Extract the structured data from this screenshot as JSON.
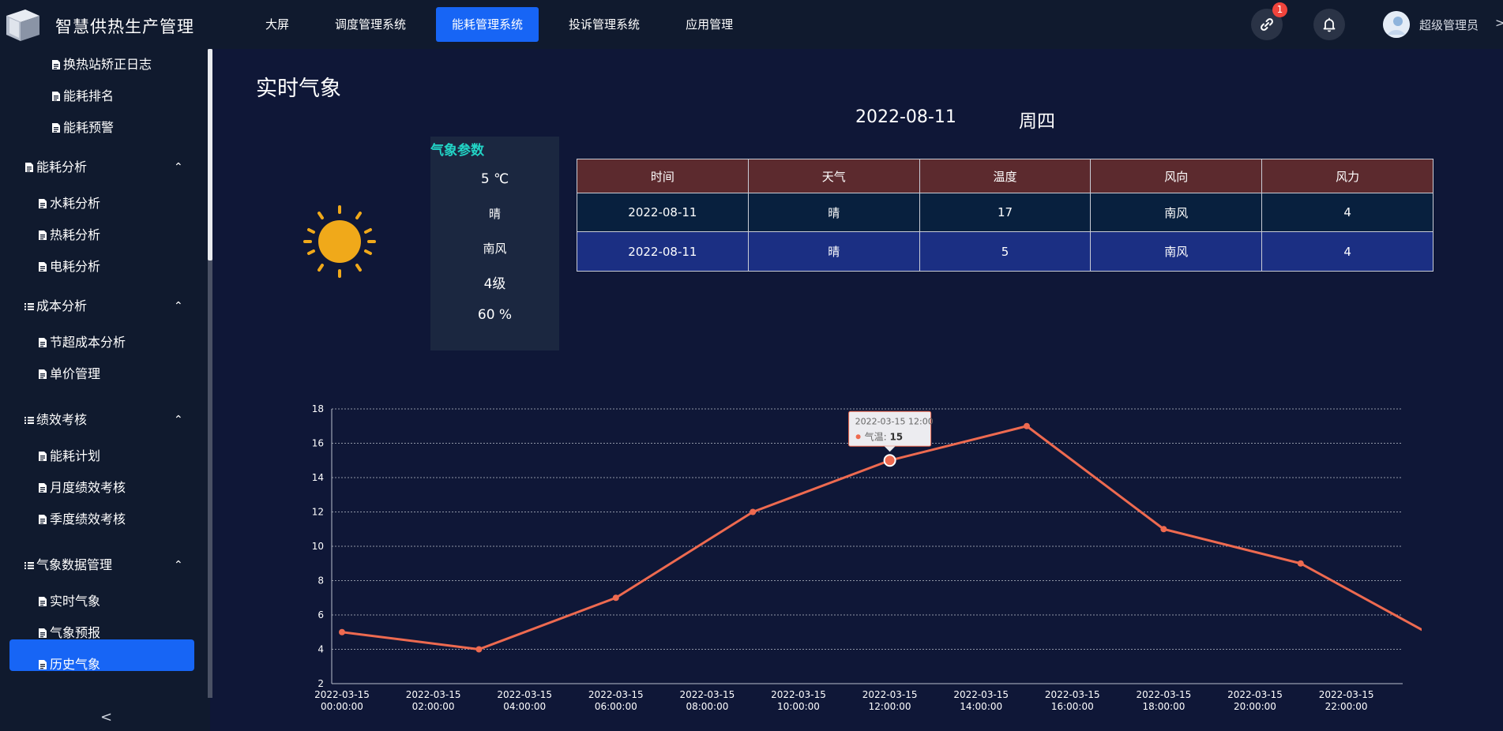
{
  "app": {
    "title": "智慧供热生产管理"
  },
  "nav": {
    "items": [
      {
        "label": "大屏"
      },
      {
        "label": "调度管理系统"
      },
      {
        "label": "能耗管理系统",
        "active": true
      },
      {
        "label": "投诉管理系统"
      },
      {
        "label": "应用管理"
      }
    ]
  },
  "header": {
    "link_badge": "1",
    "user_name": "超级管理员",
    "user_arrow": ">"
  },
  "sidebar": {
    "items": [
      {
        "label": "换热站矫正日志",
        "type": "leaf"
      },
      {
        "label": "能耗排名",
        "type": "leaf"
      },
      {
        "label": "能耗预警",
        "type": "leaf"
      },
      {
        "label": "能耗分析",
        "type": "group"
      },
      {
        "label": "水耗分析",
        "type": "leaf"
      },
      {
        "label": "热耗分析",
        "type": "leaf"
      },
      {
        "label": "电耗分析",
        "type": "leaf"
      },
      {
        "label": "成本分析",
        "type": "group"
      },
      {
        "label": "节超成本分析",
        "type": "leaf"
      },
      {
        "label": "单价管理",
        "type": "leaf"
      },
      {
        "label": "绩效考核",
        "type": "group"
      },
      {
        "label": "能耗计划",
        "type": "leaf"
      },
      {
        "label": "月度绩效考核",
        "type": "leaf"
      },
      {
        "label": "季度绩效考核",
        "type": "leaf"
      },
      {
        "label": "气象数据管理",
        "type": "group"
      },
      {
        "label": "实时气象",
        "type": "leaf",
        "active": true
      },
      {
        "label": "气象预报",
        "type": "leaf"
      },
      {
        "label": "历史气象",
        "type": "leaf"
      }
    ],
    "collapse_label": "<",
    "group_chevron": "⌃"
  },
  "main": {
    "page_title": "实时气象",
    "date": "2022-08-11",
    "weekday": "周四",
    "weather_card": {
      "title": "气象参数",
      "temperature": "5 ℃",
      "weather": "晴",
      "wind_direction": "南风",
      "wind_level": "4级",
      "humidity": "60 %"
    },
    "table": {
      "headers": [
        "时间",
        "天气",
        "温度",
        "风向",
        "风力"
      ],
      "rows": [
        [
          "2022-08-11",
          "晴",
          "17",
          "南风",
          "4"
        ],
        [
          "2022-08-11",
          "晴",
          "5",
          "南风",
          "4"
        ]
      ]
    }
  },
  "chart_data": {
    "type": "line",
    "x": [
      "2022-03-15 00:00:00",
      "2022-03-15 02:00:00",
      "2022-03-15 04:00:00",
      "2022-03-15 06:00:00",
      "2022-03-15 08:00:00",
      "2022-03-15 10:00:00",
      "2022-03-15 12:00:00",
      "2022-03-15 14:00:00",
      "2022-03-15 16:00:00",
      "2022-03-15 18:00:00",
      "2022-03-15 20:00:00",
      "2022-03-15 22:00:00"
    ],
    "point_times": [
      "00:00",
      "03:00",
      "06:00",
      "09:00",
      "12:00",
      "15:00",
      "18:00",
      "21:00",
      "23:45"
    ],
    "series": [
      {
        "name": "气温",
        "values": [
          5,
          4,
          7,
          12,
          15,
          17,
          11,
          9,
          5
        ]
      }
    ],
    "ylim": [
      2,
      18
    ],
    "yticks": [
      2,
      4,
      6,
      8,
      10,
      12,
      14,
      16,
      18
    ],
    "grid": true,
    "line_color": "#ee6a50",
    "tooltip": {
      "title": "2022-03-15 12:00",
      "series_label": "气温",
      "value": "15"
    }
  }
}
